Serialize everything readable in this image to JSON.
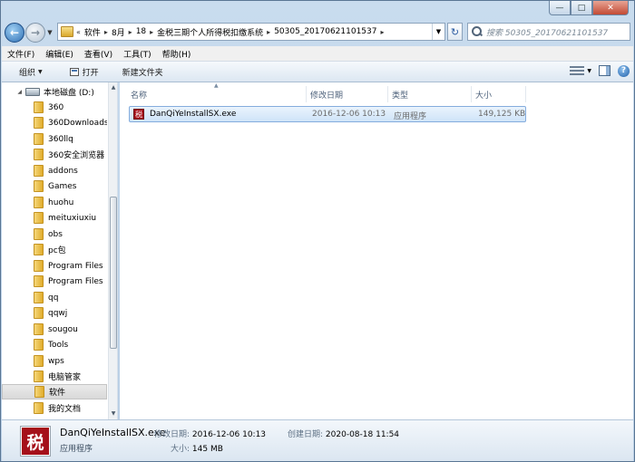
{
  "nav": {
    "crumbs": [
      "软件",
      "8月",
      "18",
      "金税三期个人所得税扣缴系统",
      "50305_20170621101537"
    ],
    "search_placeholder": "搜索 50305_20170621101537"
  },
  "menu": [
    "文件(F)",
    "编辑(E)",
    "查看(V)",
    "工具(T)",
    "帮助(H)"
  ],
  "commands": {
    "organize": "组织",
    "open": "打开",
    "new_folder": "新建文件夹"
  },
  "tree": {
    "drive": "本地磁盘 (D:)",
    "folders": [
      "360",
      "360Downloads",
      "360llq",
      "360安全浏览器",
      "addons",
      "Games",
      "huohu",
      "meituxiuxiu",
      "obs",
      "pc包",
      "Program Files",
      "Program Files",
      "qq",
      "qqwj",
      "sougou",
      "Tools",
      "wps",
      "电脑管家",
      "软件",
      "我的文档"
    ],
    "selected": "软件"
  },
  "columns": [
    "名称",
    "修改日期",
    "类型",
    "大小"
  ],
  "files": [
    {
      "name": "DanQiYeInstallSX.exe",
      "date": "2016-12-06 10:13",
      "type": "应用程序",
      "size": "149,125 KB",
      "icon_char": "税"
    }
  ],
  "details": {
    "name": "DanQiYeInstallSX.exe",
    "type": "应用程序",
    "modified_label": "修改日期:",
    "modified": "2016-12-06 10:13",
    "created_label": "创建日期:",
    "created": "2020-08-18 11:54",
    "size_label": "大小:",
    "size": "145 MB",
    "icon_char": "税"
  },
  "colors": {
    "selection": "#cfe4f8",
    "icon_red": "#a5101a"
  }
}
